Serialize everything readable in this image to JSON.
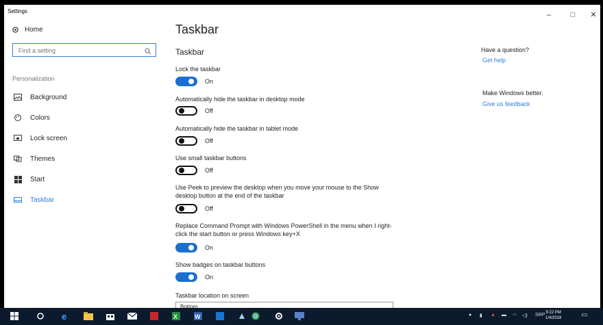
{
  "window": {
    "title": "Settings",
    "minimize": "–",
    "maximize": "□",
    "close": "✕"
  },
  "sidebar": {
    "home": "Home",
    "search_placeholder": "Find a setting",
    "section": "Personalization",
    "items": [
      {
        "label": "Background",
        "icon": "picture-icon"
      },
      {
        "label": "Colors",
        "icon": "palette-icon"
      },
      {
        "label": "Lock screen",
        "icon": "lock-screen-icon"
      },
      {
        "label": "Themes",
        "icon": "themes-icon"
      },
      {
        "label": "Start",
        "icon": "start-icon"
      },
      {
        "label": "Taskbar",
        "icon": "taskbar-icon",
        "active": true
      }
    ]
  },
  "main": {
    "title": "Taskbar",
    "section": "Taskbar",
    "settings": [
      {
        "label": "Lock the taskbar",
        "state": "On"
      },
      {
        "label": "Automatically hide the taskbar in desktop mode",
        "state": "Off"
      },
      {
        "label": "Automatically hide the taskbar in tablet mode",
        "state": "Off"
      },
      {
        "label": "Use small taskbar buttons",
        "state": "Off"
      },
      {
        "label": "Use Peek to preview the desktop when you move your mouse to the Show desktop button at the end of the taskbar",
        "state": "Off"
      },
      {
        "label": "Replace Command Prompt with Windows PowerShell in the menu when I right-click the start button or press Windows key+X",
        "state": "On"
      },
      {
        "label": "Show badges on taskbar buttons",
        "state": "On"
      }
    ],
    "location_label": "Taskbar location on screen",
    "location_value": "Bottom"
  },
  "right": {
    "question": "Have a question?",
    "get_help": "Get help",
    "make_better": "Make Windows better.",
    "feedback": "Give us feedback"
  },
  "taskbar": {
    "tray_lang": "SRP",
    "clock_time": "9:22 PM",
    "clock_date": "1/4/2018"
  },
  "colors": {
    "accent": "#1a6fd0",
    "link": "#2f7fd8",
    "taskbar": "#0c1a2e"
  }
}
